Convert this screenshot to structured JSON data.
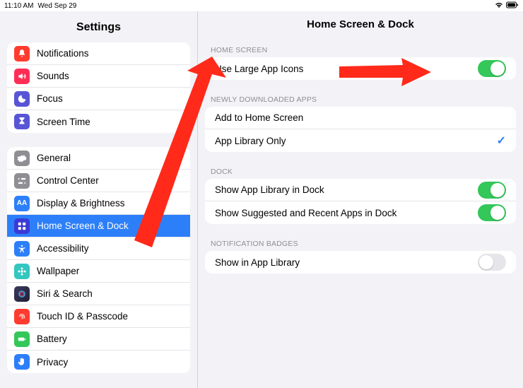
{
  "statusbar": {
    "time": "11:10 AM",
    "date": "Wed Sep 29"
  },
  "sidebar": {
    "title": "Settings",
    "group1": [
      {
        "label": "Notifications",
        "color": "#ff3b30",
        "icon": "bell"
      },
      {
        "label": "Sounds",
        "color": "#ff2d55",
        "icon": "speaker"
      },
      {
        "label": "Focus",
        "color": "#5856d6",
        "icon": "moon"
      },
      {
        "label": "Screen Time",
        "color": "#5856d6",
        "icon": "hourglass"
      }
    ],
    "group2": [
      {
        "label": "General",
        "color": "#8e8e93",
        "icon": "gear"
      },
      {
        "label": "Control Center",
        "color": "#8e8e93",
        "icon": "switches"
      },
      {
        "label": "Display & Brightness",
        "color": "#2d7ff9",
        "icon": "aa"
      },
      {
        "label": "Home Screen & Dock",
        "color": "#3a3ad6",
        "icon": "grid",
        "selected": true
      },
      {
        "label": "Accessibility",
        "color": "#2d7ff9",
        "icon": "person"
      },
      {
        "label": "Wallpaper",
        "color": "#34c7c0",
        "icon": "flower"
      },
      {
        "label": "Siri & Search",
        "color": "#1f1f37",
        "icon": "siri"
      },
      {
        "label": "Touch ID & Passcode",
        "color": "#ff3b30",
        "icon": "finger"
      },
      {
        "label": "Battery",
        "color": "#34c759",
        "icon": "battery"
      },
      {
        "label": "Privacy",
        "color": "#2d7ff9",
        "icon": "hand"
      }
    ]
  },
  "detail": {
    "title": "Home Screen & Dock",
    "sections": {
      "home_screen": {
        "header": "HOME SCREEN",
        "rows": [
          {
            "label": "Use Large App Icons",
            "toggle": true
          }
        ]
      },
      "newly_downloaded": {
        "header": "NEWLY DOWNLOADED APPS",
        "rows": [
          {
            "label": "Add to Home Screen",
            "checked": false
          },
          {
            "label": "App Library Only",
            "checked": true
          }
        ]
      },
      "dock": {
        "header": "DOCK",
        "rows": [
          {
            "label": "Show App Library in Dock",
            "toggle": true
          },
          {
            "label": "Show Suggested and Recent Apps in Dock",
            "toggle": true
          }
        ]
      },
      "badges": {
        "header": "NOTIFICATION BADGES",
        "rows": [
          {
            "label": "Show in App Library",
            "toggle": false
          }
        ]
      }
    }
  }
}
